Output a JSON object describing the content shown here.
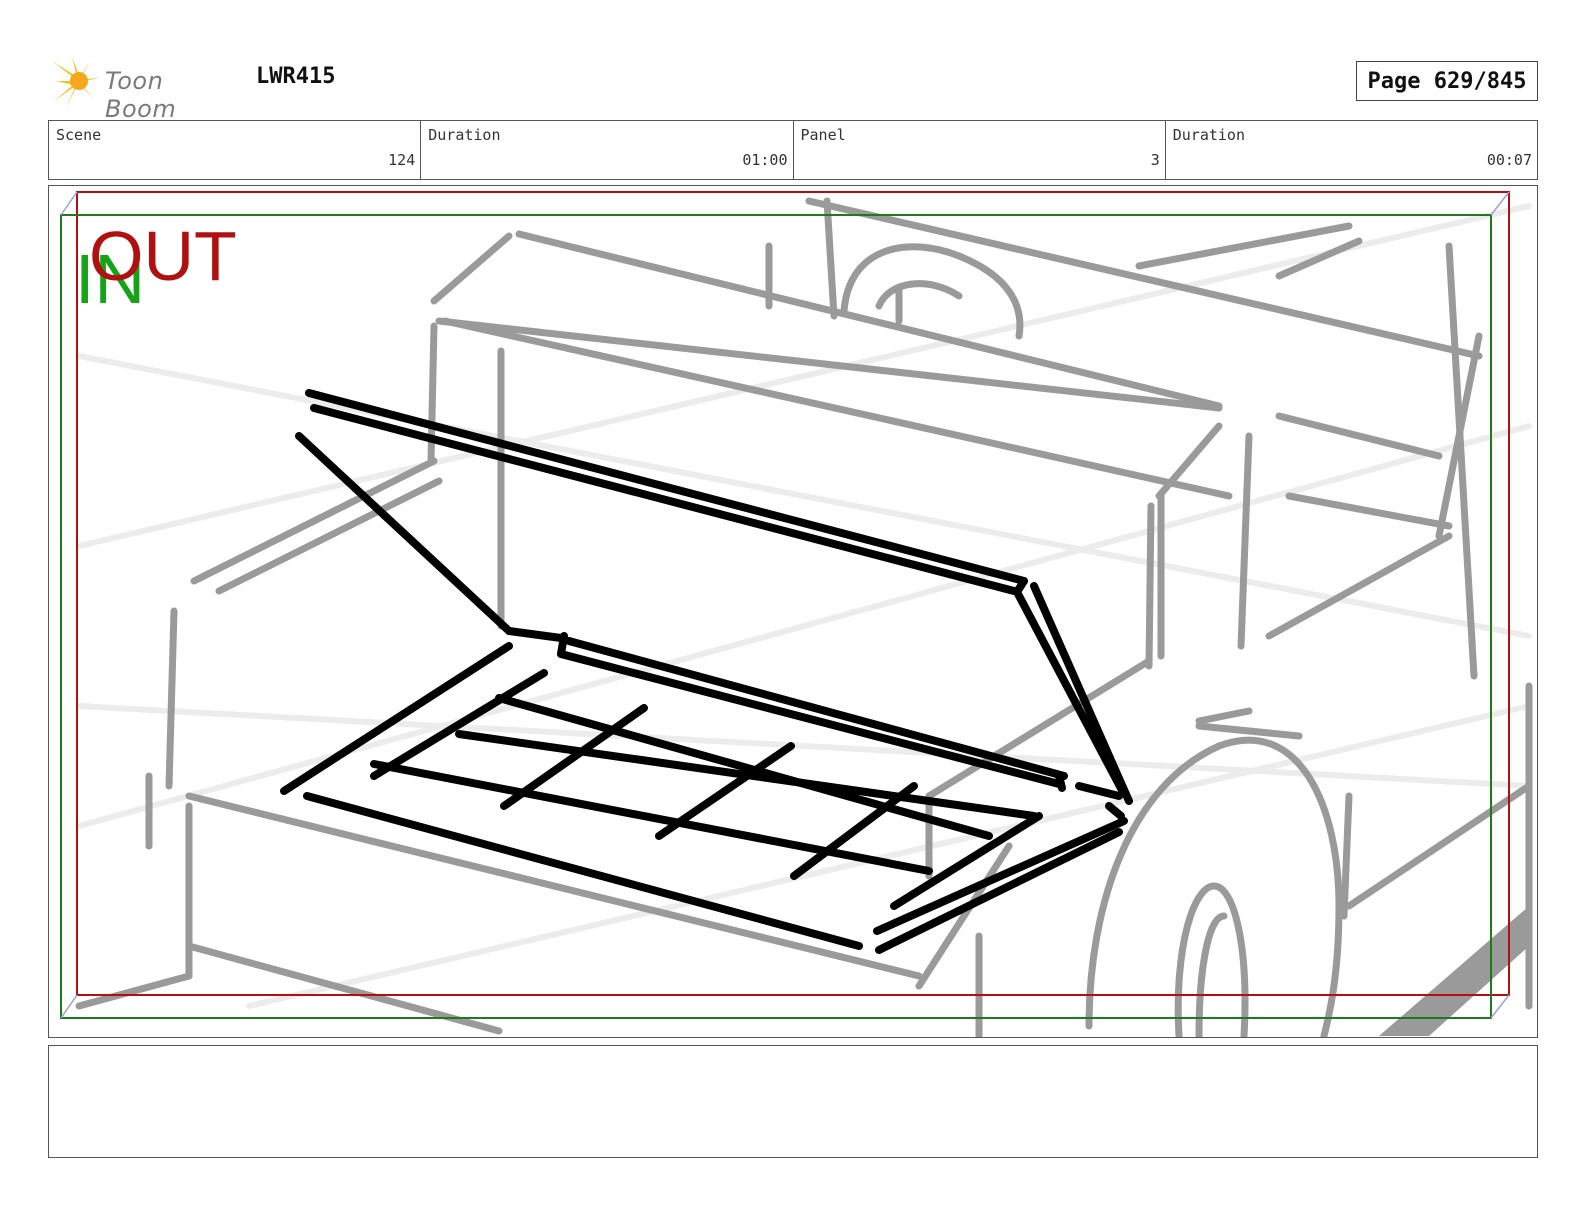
{
  "header": {
    "logo_text": "Toon Boom",
    "project_code": "LWR415",
    "page_label": "Page 629/845"
  },
  "info": [
    {
      "label": "Scene",
      "value": "124"
    },
    {
      "label": "Duration",
      "value": "01:00"
    },
    {
      "label": "Panel",
      "value": "3"
    },
    {
      "label": "Duration",
      "value": "00:07"
    }
  ],
  "panel": {
    "in_label": "IN",
    "out_label": "OUT",
    "in_color": "#17a317",
    "out_color": "#b01010",
    "sketch_gray": "#9a9a9a",
    "sketch_black": "#000000"
  },
  "notes": {
    "text": ""
  }
}
